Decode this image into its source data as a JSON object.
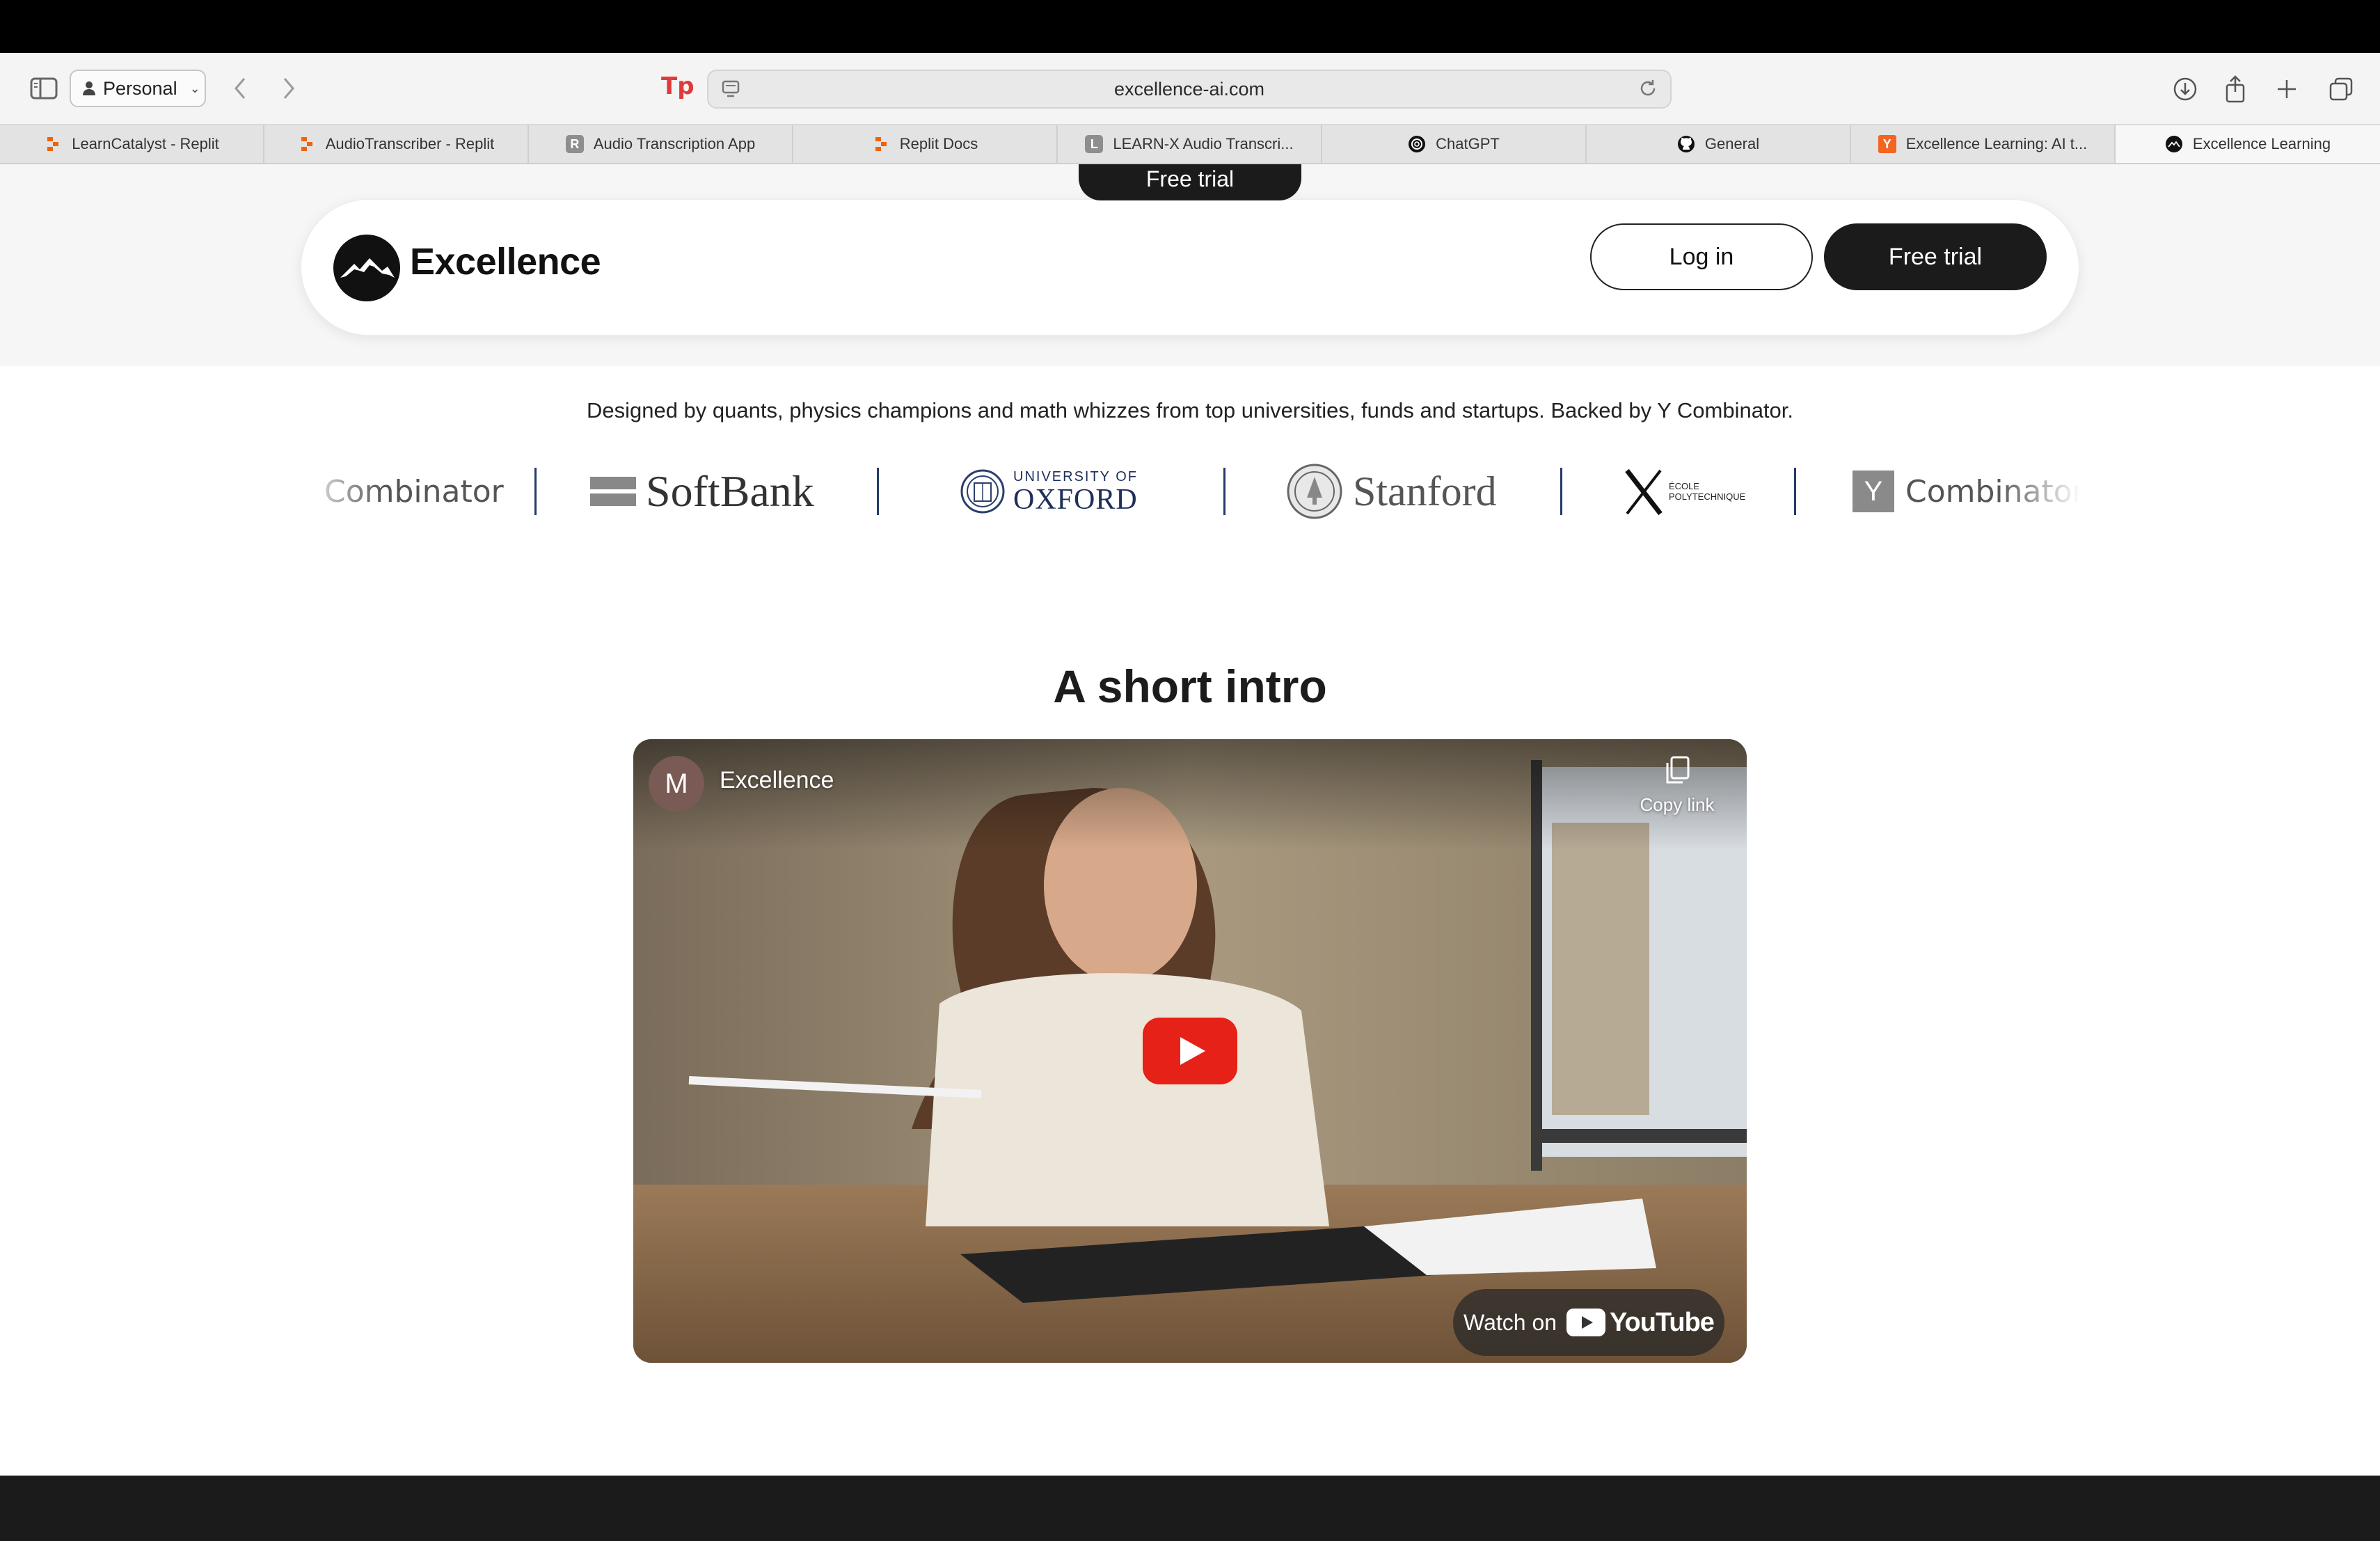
{
  "browser": {
    "profile": "Personal",
    "url": "excellence-ai.com",
    "tabs": [
      {
        "label": "LearnCatalyst - Replit",
        "icon": "replit-icon",
        "color": "#f26207"
      },
      {
        "label": "AudioTranscriber - Replit",
        "icon": "replit-icon",
        "color": "#f26207"
      },
      {
        "label": "Audio Transcription App",
        "icon": "letter-r-icon",
        "letter": "R",
        "color": "#8e8e8e"
      },
      {
        "label": "Replit Docs",
        "icon": "replit-icon",
        "color": "#f26207"
      },
      {
        "label": "LEARN-X Audio Transcri...",
        "icon": "letter-l-icon",
        "letter": "L",
        "color": "#8e8e8e"
      },
      {
        "label": "ChatGPT",
        "icon": "chatgpt-icon",
        "color": "#111111"
      },
      {
        "label": "General",
        "icon": "github-icon",
        "color": "#111111"
      },
      {
        "label": "Excellence Learning: AI t...",
        "icon": "ycombinator-icon",
        "letter": "Y",
        "color": "#f26522"
      },
      {
        "label": "Excellence Learning",
        "icon": "excellence-icon",
        "color": "#111111"
      }
    ]
  },
  "page": {
    "floating_cta": "Free trial",
    "brand": "Excellence",
    "login_label": "Log in",
    "trial_label": "Free trial",
    "tagline": "Designed by quants, physics champions and math whizzes from top universities, funds and startups. Backed by Y Combinator.",
    "logos": {
      "ycombinator_partial": "Combinator",
      "softbank": "SoftBank",
      "oxford_top": "UNIVERSITY OF",
      "oxford_bottom": "OXFORD",
      "stanford": "Stanford",
      "polytechnique_top": "ÉCOLE",
      "polytechnique_bottom": "POLYTECHNIQUE",
      "ycombinator_letter": "Y",
      "ycombinator": "Combinator"
    },
    "intro_title": "A short intro",
    "video": {
      "channel_initial": "M",
      "channel_name": "Excellence",
      "copy_link": "Copy link",
      "watch_on": "Watch on",
      "youtube": "YouTube"
    }
  },
  "colors": {
    "accent_dark": "#1b1b1b",
    "youtube_red": "#e62117"
  }
}
